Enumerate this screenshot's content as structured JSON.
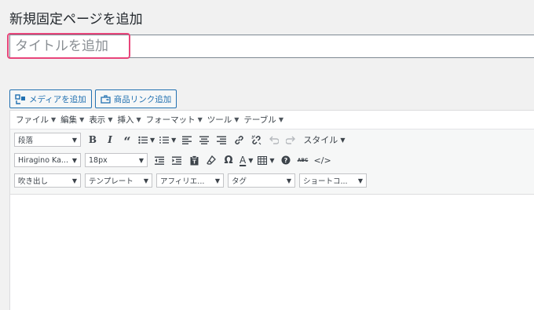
{
  "page": {
    "title": "新規固定ページを追加"
  },
  "title_field": {
    "placeholder": "タイトルを追加"
  },
  "media_buttons": [
    {
      "label": "メディアを追加",
      "icon": "media-add-icon"
    },
    {
      "label": "商品リンク追加",
      "icon": "product-link-icon"
    }
  ],
  "menubar": {
    "items": [
      "ファイル",
      "編集",
      "表示",
      "挿入",
      "フォーマット",
      "ツール",
      "テーブル"
    ]
  },
  "toolbar1": {
    "paragraph_select": "段落",
    "style_label": "スタイル"
  },
  "toolbar2": {
    "font_family_select": "Hiragino Ka...",
    "font_size_select": "18px",
    "abc_label": "ABC"
  },
  "toolbar3": {
    "balloon_select": "吹き出し",
    "template_select": "テンプレート",
    "affiliate_select": "アフィリエ...",
    "tag_select": "タグ",
    "shortcode_select": "ショートコ..."
  },
  "colors": {
    "accent": "#2271b1",
    "highlight": "#e8457a"
  }
}
